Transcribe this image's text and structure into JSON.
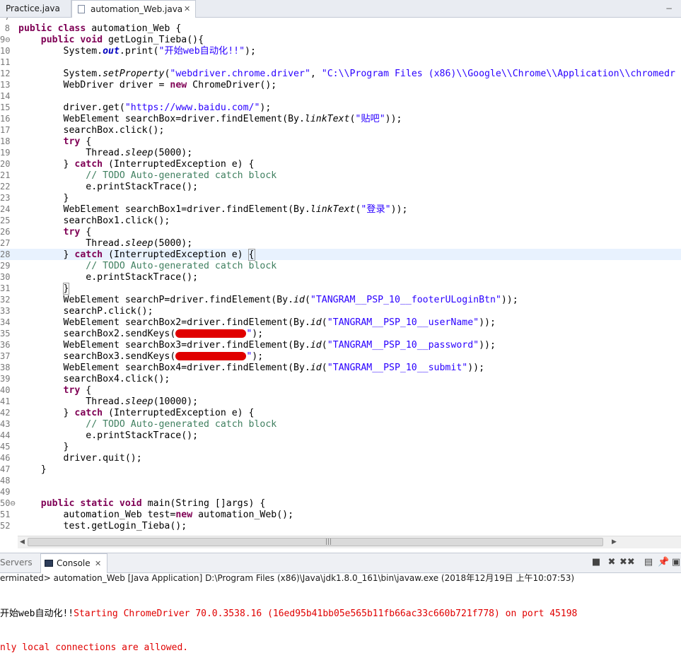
{
  "tabs": {
    "inactive_label": "Practice.java",
    "active_label": "automation_Web.java",
    "close_glyph": "✕",
    "minimize_glyph": "−"
  },
  "editor": {
    "lines": [
      {
        "n": "7",
        "hl": false,
        "segs": []
      },
      {
        "n": "8",
        "hl": false,
        "segs": [
          {
            "t": "k",
            "v": "public class"
          },
          {
            "t": "p",
            "v": " automation_Web {"
          }
        ]
      },
      {
        "n": "9⊖",
        "hl": false,
        "segs": [
          {
            "t": "p",
            "v": "    "
          },
          {
            "t": "k",
            "v": "public void"
          },
          {
            "t": "p",
            "v": " getLogin_Tieba(){"
          }
        ]
      },
      {
        "n": "10",
        "hl": false,
        "segs": [
          {
            "t": "p",
            "v": "        System."
          },
          {
            "t": "fld",
            "v": "out"
          },
          {
            "t": "p",
            "v": ".print("
          },
          {
            "t": "s",
            "v": "\"开始web自动化!!\""
          },
          {
            "t": "p",
            "v": ");"
          }
        ]
      },
      {
        "n": "11",
        "hl": false,
        "segs": []
      },
      {
        "n": "12",
        "hl": false,
        "segs": [
          {
            "t": "p",
            "v": "        System."
          },
          {
            "t": "st",
            "v": "setProperty"
          },
          {
            "t": "p",
            "v": "("
          },
          {
            "t": "s",
            "v": "\"webdriver.chrome.driver\""
          },
          {
            "t": "p",
            "v": ", "
          },
          {
            "t": "s",
            "v": "\"C:\\\\Program Files (x86)\\\\Google\\\\Chrome\\\\Application\\\\chromedr"
          }
        ]
      },
      {
        "n": "13",
        "hl": false,
        "segs": [
          {
            "t": "p",
            "v": "        WebDriver driver = "
          },
          {
            "t": "k",
            "v": "new"
          },
          {
            "t": "p",
            "v": " ChromeDriver();"
          }
        ]
      },
      {
        "n": "14",
        "hl": false,
        "segs": []
      },
      {
        "n": "15",
        "hl": false,
        "segs": [
          {
            "t": "p",
            "v": "        driver.get("
          },
          {
            "t": "s",
            "v": "\"https://www.baidu.com/\""
          },
          {
            "t": "p",
            "v": ");"
          }
        ]
      },
      {
        "n": "16",
        "hl": false,
        "segs": [
          {
            "t": "p",
            "v": "        WebElement searchBox=driver.findElement(By."
          },
          {
            "t": "st",
            "v": "linkText"
          },
          {
            "t": "p",
            "v": "("
          },
          {
            "t": "s",
            "v": "\"贴吧\""
          },
          {
            "t": "p",
            "v": "));"
          }
        ]
      },
      {
        "n": "17",
        "hl": false,
        "segs": [
          {
            "t": "p",
            "v": "        searchBox.click();"
          }
        ]
      },
      {
        "n": "18",
        "hl": false,
        "segs": [
          {
            "t": "p",
            "v": "        "
          },
          {
            "t": "k",
            "v": "try"
          },
          {
            "t": "p",
            "v": " {"
          }
        ]
      },
      {
        "n": "19",
        "hl": false,
        "segs": [
          {
            "t": "p",
            "v": "            Thread."
          },
          {
            "t": "st",
            "v": "sleep"
          },
          {
            "t": "p",
            "v": "(5000);"
          }
        ]
      },
      {
        "n": "20",
        "hl": false,
        "segs": [
          {
            "t": "p",
            "v": "        } "
          },
          {
            "t": "k",
            "v": "catch"
          },
          {
            "t": "p",
            "v": " (InterruptedException e) {"
          }
        ]
      },
      {
        "n": "21",
        "hl": false,
        "segs": [
          {
            "t": "c",
            "v": "            // TODO Auto-generated catch block"
          }
        ]
      },
      {
        "n": "22",
        "hl": false,
        "segs": [
          {
            "t": "p",
            "v": "            e.printStackTrace();"
          }
        ]
      },
      {
        "n": "23",
        "hl": false,
        "segs": [
          {
            "t": "p",
            "v": "        }"
          }
        ]
      },
      {
        "n": "24",
        "hl": false,
        "segs": [
          {
            "t": "p",
            "v": "        WebElement searchBox1=driver.findElement(By."
          },
          {
            "t": "st",
            "v": "linkText"
          },
          {
            "t": "p",
            "v": "("
          },
          {
            "t": "s",
            "v": "\"登录\""
          },
          {
            "t": "p",
            "v": "));"
          }
        ]
      },
      {
        "n": "25",
        "hl": false,
        "segs": [
          {
            "t": "p",
            "v": "        searchBox1.click();"
          }
        ]
      },
      {
        "n": "26",
        "hl": false,
        "segs": [
          {
            "t": "p",
            "v": "        "
          },
          {
            "t": "k",
            "v": "try"
          },
          {
            "t": "p",
            "v": " {"
          }
        ]
      },
      {
        "n": "27",
        "hl": false,
        "segs": [
          {
            "t": "p",
            "v": "            Thread."
          },
          {
            "t": "st",
            "v": "sleep"
          },
          {
            "t": "p",
            "v": "(5000);"
          }
        ]
      },
      {
        "n": "28",
        "hl": true,
        "segs": [
          {
            "t": "p",
            "v": "        } "
          },
          {
            "t": "k",
            "v": "catch"
          },
          {
            "t": "p",
            "v": " (InterruptedException e) "
          },
          {
            "t": "br",
            "v": "{"
          }
        ]
      },
      {
        "n": "29",
        "hl": false,
        "segs": [
          {
            "t": "c",
            "v": "            // TODO Auto-generated catch block"
          }
        ]
      },
      {
        "n": "30",
        "hl": false,
        "segs": [
          {
            "t": "p",
            "v": "            e.printStackTrace();"
          }
        ]
      },
      {
        "n": "31",
        "hl": false,
        "segs": [
          {
            "t": "p",
            "v": "        "
          },
          {
            "t": "br",
            "v": "}"
          }
        ]
      },
      {
        "n": "32",
        "hl": false,
        "segs": [
          {
            "t": "p",
            "v": "        WebElement searchP=driver.findElement(By."
          },
          {
            "t": "st",
            "v": "id"
          },
          {
            "t": "p",
            "v": "("
          },
          {
            "t": "s",
            "v": "\"TANGRAM__PSP_10__footerULoginBtn\""
          },
          {
            "t": "p",
            "v": "));"
          }
        ]
      },
      {
        "n": "33",
        "hl": false,
        "segs": [
          {
            "t": "p",
            "v": "        searchP.click();"
          }
        ]
      },
      {
        "n": "34",
        "hl": false,
        "segs": [
          {
            "t": "p",
            "v": "        WebElement searchBox2=driver.findElement(By."
          },
          {
            "t": "st",
            "v": "id"
          },
          {
            "t": "p",
            "v": "("
          },
          {
            "t": "s",
            "v": "\"TANGRAM__PSP_10__userName\""
          },
          {
            "t": "p",
            "v": "));"
          }
        ]
      },
      {
        "n": "35",
        "hl": false,
        "segs": [
          {
            "t": "p",
            "v": "        searchBox2.sendKeys("
          },
          {
            "t": "red",
            "v": "xxxxxxxxxxxxx"
          },
          {
            "t": "s",
            "v": "\""
          },
          {
            "t": "p",
            "v": ");"
          }
        ]
      },
      {
        "n": "36",
        "hl": false,
        "segs": [
          {
            "t": "p",
            "v": "        WebElement searchBox3=driver.findElement(By."
          },
          {
            "t": "st",
            "v": "id"
          },
          {
            "t": "p",
            "v": "("
          },
          {
            "t": "s",
            "v": "\"TANGRAM__PSP_10__password\""
          },
          {
            "t": "p",
            "v": "));"
          }
        ]
      },
      {
        "n": "37",
        "hl": false,
        "segs": [
          {
            "t": "p",
            "v": "        searchBox3.sendKeys("
          },
          {
            "t": "red",
            "v": "xxxxxxxxxxxx"
          },
          {
            "t": "s",
            "v": "\""
          },
          {
            "t": "p",
            "v": ");"
          }
        ]
      },
      {
        "n": "38",
        "hl": false,
        "segs": [
          {
            "t": "p",
            "v": "        WebElement searchBox4=driver.findElement(By."
          },
          {
            "t": "st",
            "v": "id"
          },
          {
            "t": "p",
            "v": "("
          },
          {
            "t": "s",
            "v": "\"TANGRAM__PSP_10__submit\""
          },
          {
            "t": "p",
            "v": "));"
          }
        ]
      },
      {
        "n": "39",
        "hl": false,
        "segs": [
          {
            "t": "p",
            "v": "        searchBox4.click();"
          }
        ]
      },
      {
        "n": "40",
        "hl": false,
        "segs": [
          {
            "t": "p",
            "v": "        "
          },
          {
            "t": "k",
            "v": "try"
          },
          {
            "t": "p",
            "v": " {"
          }
        ]
      },
      {
        "n": "41",
        "hl": false,
        "segs": [
          {
            "t": "p",
            "v": "            Thread."
          },
          {
            "t": "st",
            "v": "sleep"
          },
          {
            "t": "p",
            "v": "(10000);"
          }
        ]
      },
      {
        "n": "42",
        "hl": false,
        "segs": [
          {
            "t": "p",
            "v": "        } "
          },
          {
            "t": "k",
            "v": "catch"
          },
          {
            "t": "p",
            "v": " (InterruptedException e) {"
          }
        ]
      },
      {
        "n": "43",
        "hl": false,
        "segs": [
          {
            "t": "c",
            "v": "            // TODO Auto-generated catch block"
          }
        ]
      },
      {
        "n": "44",
        "hl": false,
        "segs": [
          {
            "t": "p",
            "v": "            e.printStackTrace();"
          }
        ]
      },
      {
        "n": "45",
        "hl": false,
        "segs": [
          {
            "t": "p",
            "v": "        }"
          }
        ]
      },
      {
        "n": "46",
        "hl": false,
        "segs": [
          {
            "t": "p",
            "v": "        driver.quit();"
          }
        ]
      },
      {
        "n": "47",
        "hl": false,
        "segs": [
          {
            "t": "p",
            "v": "    }"
          }
        ]
      },
      {
        "n": "48",
        "hl": false,
        "segs": []
      },
      {
        "n": "49",
        "hl": false,
        "segs": []
      },
      {
        "n": "50⊖",
        "hl": false,
        "segs": [
          {
            "t": "p",
            "v": "    "
          },
          {
            "t": "k",
            "v": "public static void"
          },
          {
            "t": "p",
            "v": " main(String []args) {"
          }
        ]
      },
      {
        "n": "51",
        "hl": false,
        "segs": [
          {
            "t": "p",
            "v": "        automation_Web test="
          },
          {
            "t": "k",
            "v": "new"
          },
          {
            "t": "p",
            "v": " automation_Web();"
          }
        ]
      },
      {
        "n": "52",
        "hl": false,
        "segs": [
          {
            "t": "p",
            "v": "        test.getLogin_Tieba();"
          }
        ]
      }
    ]
  },
  "scrollbar": {
    "left_arrow": "◀",
    "right_arrow": "▶",
    "grip": "|||"
  },
  "console": {
    "servers_label": "Servers",
    "console_label": "Console",
    "close_glyph": "✕",
    "toolbar_icons": [
      "stop-icon",
      "remove-launch-icon",
      "remove-all-icon",
      "scroll-lock-icon",
      "pin-icon",
      "display-console-icon"
    ],
    "toolbar_glyphs": [
      "■",
      "✖",
      "✖✖",
      "▤",
      "📌",
      "▣"
    ],
    "status": "erminated> automation_Web [Java Application] D:\\Program Files (x86)\\Java\\jdk1.8.0_161\\bin\\javaw.exe (2018年12月19日 上午10:07:53)",
    "out_line1_black": "开始web自动化!!",
    "out_line1_red": "Starting ChromeDriver 70.0.3538.16 (16ed95b41bb05e565b11fb66ac33c660b721f778) on port 45198",
    "out_line2_red": "nly local connections are allowed."
  }
}
